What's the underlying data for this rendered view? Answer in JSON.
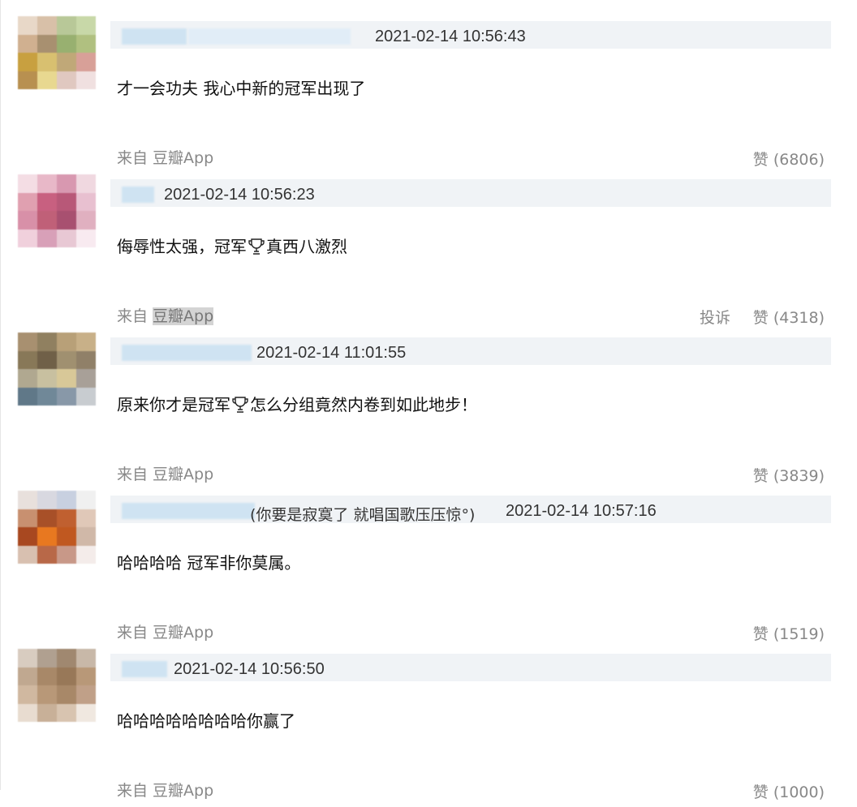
{
  "comments": [
    {
      "handle": "",
      "time": "2021-02-14 10:56:43",
      "text": "才一会功夫 我心中新的冠军出现了",
      "source_label": "来自",
      "source_app": "豆瓣App",
      "report_label": "",
      "like_label": "赞 (6806)"
    },
    {
      "handle": "",
      "time": "2021-02-14 10:56:23",
      "text_before": "侮辱性太强，冠军",
      "text_after": "真西八激烈",
      "source_label": "来自",
      "source_app": "豆瓣App",
      "report_label": "投诉",
      "like_label": "赞 (4318)"
    },
    {
      "handle": "",
      "time": "2021-02-14 11:01:55",
      "text_before": "原来你才是冠军",
      "text_after": "怎么分组竟然内卷到如此地步！",
      "source_label": "来自",
      "source_app": "豆瓣App",
      "report_label": "",
      "like_label": "赞 (3839)"
    },
    {
      "handle": "(你要是寂寞了 就唱国歌压压惊°)",
      "time": "2021-02-14 10:57:16",
      "text": "哈哈哈哈 冠军非你莫属。",
      "source_label": "来自",
      "source_app": "豆瓣App",
      "report_label": "",
      "like_label": "赞 (1519)"
    },
    {
      "handle": "",
      "time": "2021-02-14 10:56:50",
      "text": "哈哈哈哈哈哈哈哈你赢了",
      "source_label": "来自",
      "source_app": "豆瓣App",
      "report_label": "",
      "like_label": "赞 (1000)"
    }
  ],
  "colors": {
    "meta_bar": "#f0f3f6",
    "muted_text": "#888888",
    "body_text": "#111111",
    "name_blur": "#cfe3f2"
  },
  "icons": [
    "trophy-icon"
  ]
}
